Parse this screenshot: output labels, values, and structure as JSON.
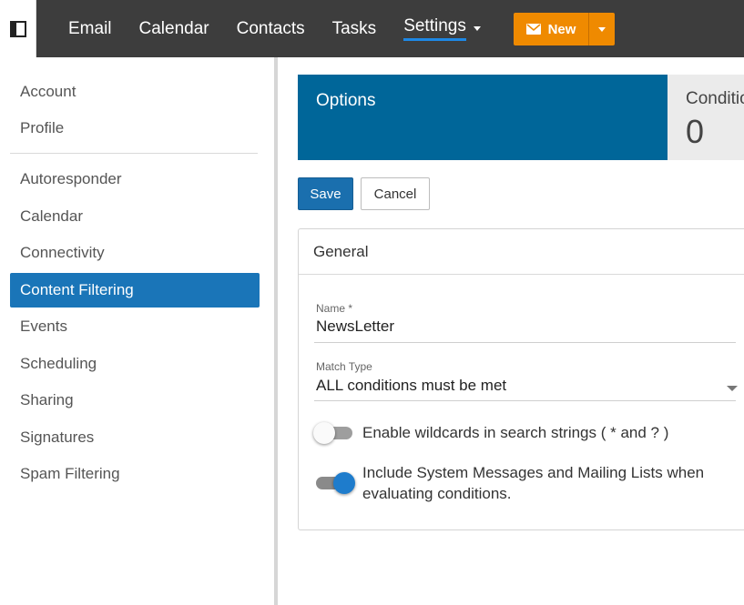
{
  "topbar": {
    "nav": [
      {
        "label": "Email"
      },
      {
        "label": "Calendar"
      },
      {
        "label": "Contacts"
      },
      {
        "label": "Tasks"
      },
      {
        "label": "Settings",
        "active": true,
        "has_dropdown": true
      }
    ],
    "new_button": {
      "label": "New",
      "icon": "envelope-icon"
    }
  },
  "sidebar": {
    "group1": [
      "Account",
      "Profile"
    ],
    "group2": [
      "Autoresponder",
      "Calendar",
      "Connectivity",
      "Content Filtering",
      "Events",
      "Scheduling",
      "Sharing",
      "Signatures",
      "Spam Filtering"
    ],
    "active": "Content Filtering"
  },
  "tabs": {
    "options": {
      "label": "Options"
    },
    "conditions": {
      "label": "Conditions",
      "count": "0"
    }
  },
  "buttons": {
    "save": "Save",
    "cancel": "Cancel"
  },
  "general": {
    "title": "General",
    "name_label": "Name *",
    "name_value": "NewsLetter",
    "match_label": "Match Type",
    "match_value": "ALL conditions must be met",
    "wildcards_label": "Enable wildcards in search strings ( * and ? )",
    "wildcards_enabled": false,
    "system_label": "Include System Messages and Mailing Lists when evaluating conditions.",
    "system_enabled": true
  },
  "colors": {
    "topbar": "#3d3d3d",
    "accent": "#1a75b8",
    "new_button": "#ef8a00",
    "tab_active": "#006699"
  }
}
